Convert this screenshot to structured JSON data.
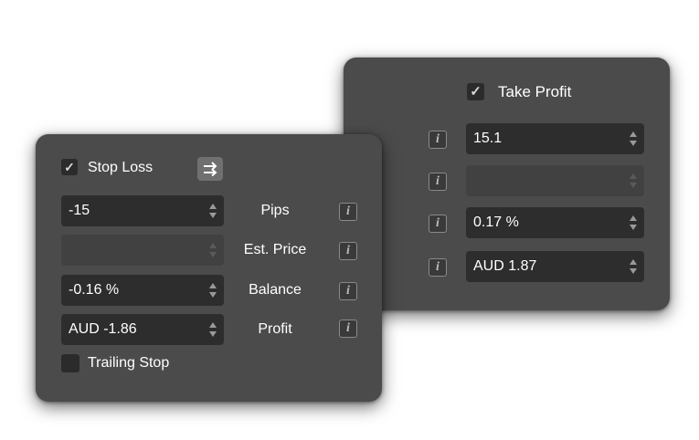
{
  "take_profit": {
    "checkbox_label": "Take Profit",
    "checked": true,
    "fields": [
      {
        "value": "15.1",
        "disabled": false
      },
      {
        "value": "",
        "disabled": true
      },
      {
        "value": "0.17 %",
        "disabled": false
      },
      {
        "value": "AUD 1.87",
        "disabled": false
      }
    ],
    "info_glyph": "i"
  },
  "stop_loss": {
    "checkbox_label": "Stop Loss",
    "checked": true,
    "swap_icon": "swap-arrows-icon",
    "rows": [
      {
        "value": "-15",
        "label": "Pips",
        "disabled": false
      },
      {
        "value": "",
        "label": "Est. Price",
        "disabled": true
      },
      {
        "value": "-0.16 %",
        "label": "Balance",
        "disabled": false
      },
      {
        "value": "AUD -1.86",
        "label": "Profit",
        "disabled": false
      }
    ],
    "trailing_stop_label": "Trailing Stop",
    "trailing_checked": false,
    "info_glyph": "i"
  }
}
